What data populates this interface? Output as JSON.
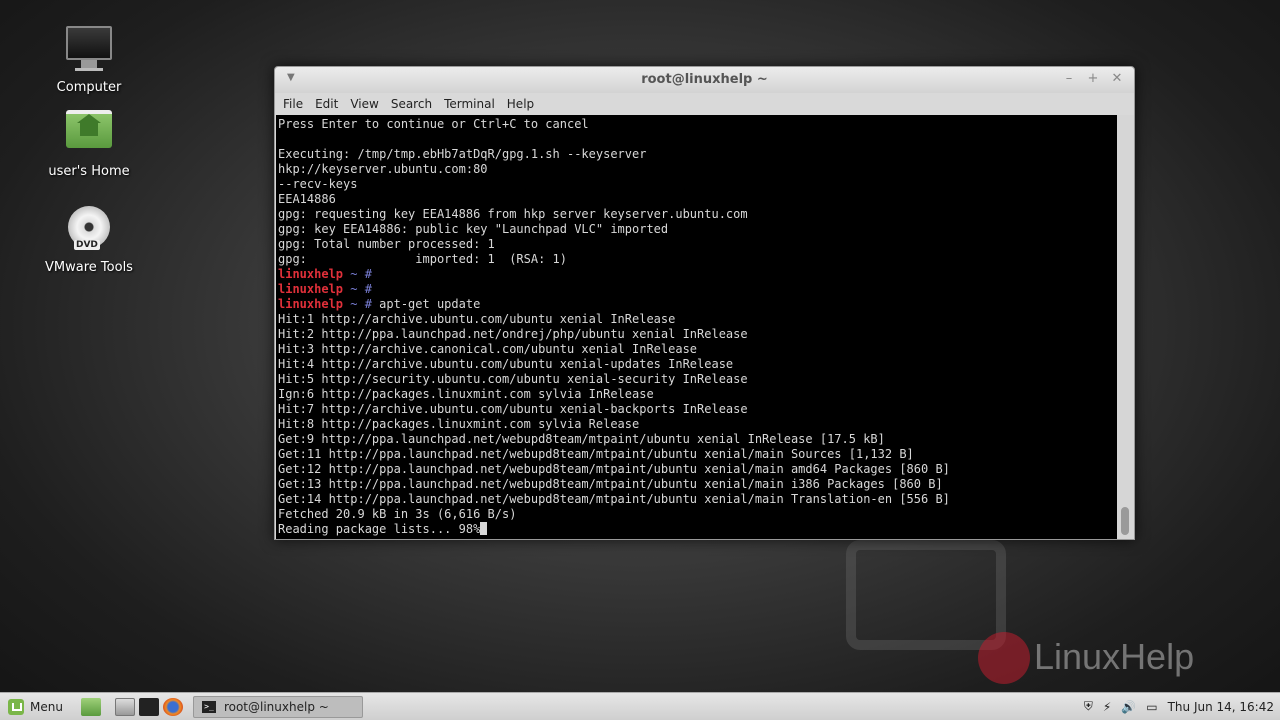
{
  "desktop": {
    "icons": [
      {
        "label": "Computer"
      },
      {
        "label": "user's Home"
      },
      {
        "label": "VMware Tools"
      }
    ],
    "watermark_text": "LinuxHelp"
  },
  "window": {
    "title": "root@linuxhelp ~",
    "menu": [
      "File",
      "Edit",
      "View",
      "Search",
      "Terminal",
      "Help"
    ],
    "terminal_lines": [
      "Press Enter to continue or Ctrl+C to cancel",
      "",
      "Executing: /tmp/tmp.ebHb7atDqR/gpg.1.sh --keyserver",
      "hkp://keyserver.ubuntu.com:80",
      "--recv-keys",
      "EEA14886",
      "gpg: requesting key EEA14886 from hkp server keyserver.ubuntu.com",
      "gpg: key EEA14886: public key \"Launchpad VLC\" imported",
      "gpg: Total number processed: 1",
      "gpg:               imported: 1  (RSA: 1)"
    ],
    "prompts": [
      {
        "host": "linuxhelp",
        "rest": " ~ #",
        "command": ""
      },
      {
        "host": "linuxhelp",
        "rest": " ~ #",
        "command": ""
      },
      {
        "host": "linuxhelp",
        "rest": " ~ #",
        "command": " apt-get update"
      }
    ],
    "output_lines": [
      "Hit:1 http://archive.ubuntu.com/ubuntu xenial InRelease",
      "Hit:2 http://ppa.launchpad.net/ondrej/php/ubuntu xenial InRelease",
      "Hit:3 http://archive.canonical.com/ubuntu xenial InRelease",
      "Hit:4 http://archive.ubuntu.com/ubuntu xenial-updates InRelease",
      "Hit:5 http://security.ubuntu.com/ubuntu xenial-security InRelease",
      "Ign:6 http://packages.linuxmint.com sylvia InRelease",
      "Hit:7 http://archive.ubuntu.com/ubuntu xenial-backports InRelease",
      "Hit:8 http://packages.linuxmint.com sylvia Release",
      "Get:9 http://ppa.launchpad.net/webupd8team/mtpaint/ubuntu xenial InRelease [17.5 kB]",
      "Get:11 http://ppa.launchpad.net/webupd8team/mtpaint/ubuntu xenial/main Sources [1,132 B]",
      "Get:12 http://ppa.launchpad.net/webupd8team/mtpaint/ubuntu xenial/main amd64 Packages [860 B]",
      "Get:13 http://ppa.launchpad.net/webupd8team/mtpaint/ubuntu xenial/main i386 Packages [860 B]",
      "Get:14 http://ppa.launchpad.net/webupd8team/mtpaint/ubuntu xenial/main Translation-en [556 B]",
      "Fetched 20.9 kB in 3s (6,616 B/s)",
      "Reading package lists... 98%"
    ]
  },
  "taskbar": {
    "menu_label": "Menu",
    "task_label": "root@linuxhelp ~",
    "clock": "Thu Jun 14, 16:42"
  },
  "colors": {
    "prompt_host": "#e0303a",
    "prompt_path": "#7a7fd6",
    "terminal_bg": "#000000",
    "terminal_fg": "#d8d8d8"
  }
}
